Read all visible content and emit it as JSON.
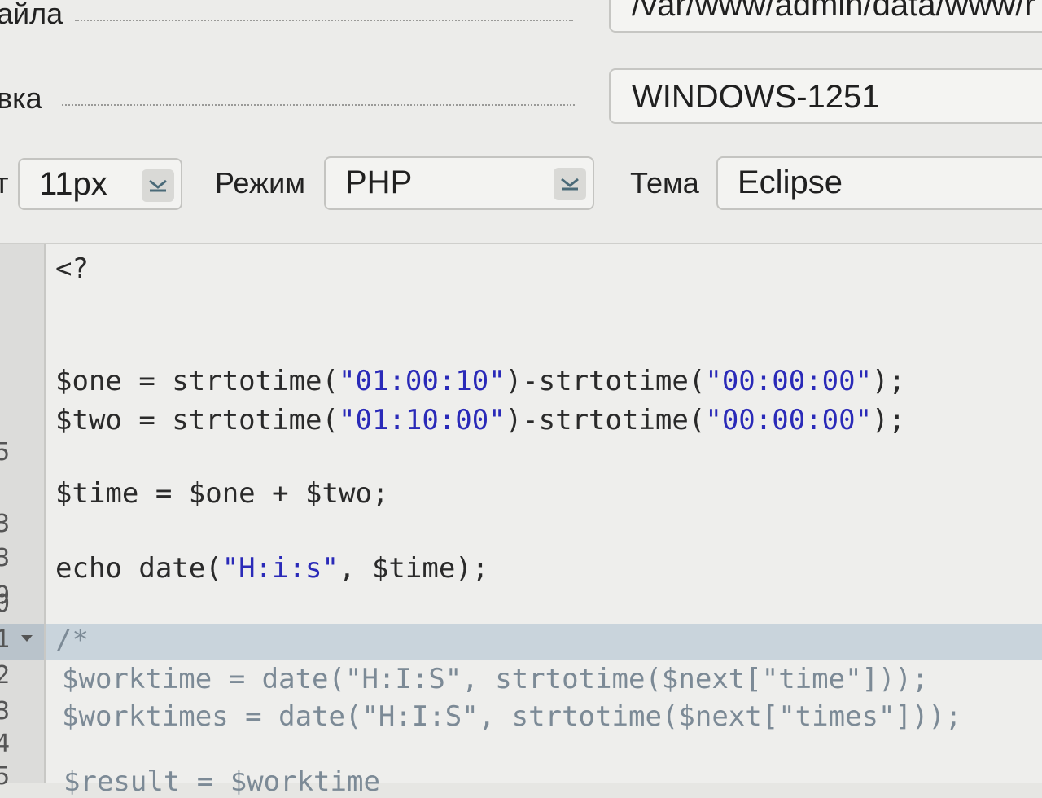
{
  "form": {
    "path_label": "айла",
    "path_value": "/var/www/admin/data/www/r",
    "encoding_label": "вка",
    "encoding_value": "WINDOWS-1251",
    "font_label": "т",
    "font_value": "11px",
    "mode_label": "Режим",
    "mode_value": "PHP",
    "theme_label": "Тема",
    "theme_value": "Eclipse"
  },
  "editor": {
    "line_numbers": [
      "5",
      "3",
      "3",
      "9",
      "0",
      "1",
      "2",
      "3",
      "4",
      "5"
    ],
    "lines": {
      "open_tag": "<?",
      "one": {
        "pre": "$one = strtotime(",
        "s1": "\"01:00:10\"",
        "mid": ")-strtotime(",
        "s2": "\"00:00:00\"",
        "post": ");"
      },
      "two": {
        "pre": "$two = strtotime(",
        "s1": "\"01:10:00\"",
        "mid": ")-strtotime(",
        "s2": "\"00:00:00\"",
        "post": ");"
      },
      "time": "$time = $one + $two;",
      "echo": {
        "pre": "echo date(",
        "s1": "\"H:i:s\"",
        "post": ", $time);"
      },
      "comment_open": "/*",
      "worktime": "$worktime = date(\"H:I:S\", strtotime($next[\"time\"]));",
      "worktimes": "$worktimes = date(\"H:I:S\", strtotime($next[\"times\"]));",
      "result_partial": "$result = $worktime"
    }
  },
  "colors": {
    "string": "#2a2ab8",
    "comment": "#7c8a96",
    "active_line": "#c9d4dc"
  }
}
